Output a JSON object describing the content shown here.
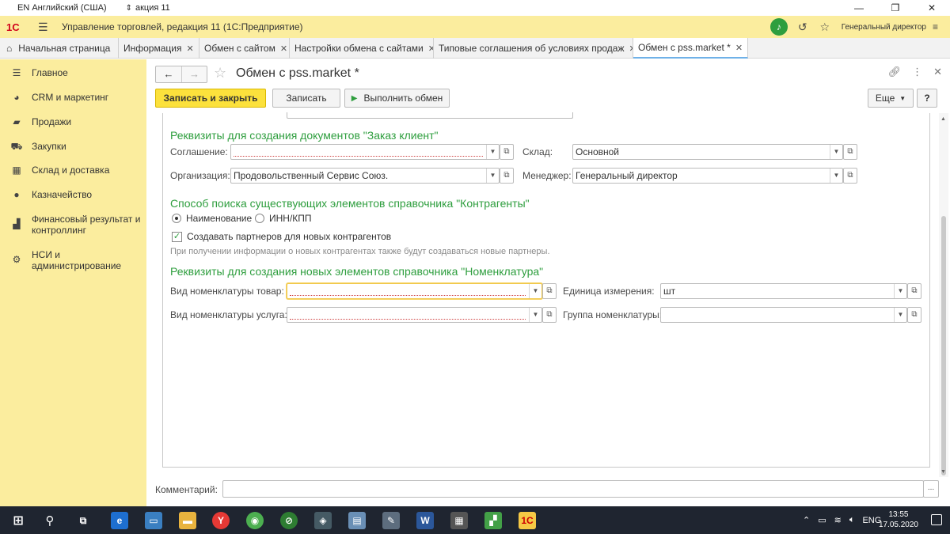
{
  "os": {
    "language": "EN Английский (США)",
    "doc_name": "акция 11",
    "taskbar_time": "13:55",
    "taskbar_date": "17.05.2020"
  },
  "app": {
    "logo": "1С",
    "title": "Управление торговлей, редакция 11  (1С:Предприятие)",
    "user": "Генеральный директор",
    "accent_color": "#fbed9e",
    "primary_button_color": "#fce13c",
    "section_color": "#2e9e3e"
  },
  "tabs": [
    {
      "label": "Начальная страница"
    },
    {
      "label": "Информация"
    },
    {
      "label": "Обмен с сайтом"
    },
    {
      "label": "Настройки обмена с сайтами"
    },
    {
      "label": "Типовые соглашения об условиях продаж"
    },
    {
      "label": "Обмен с pss.market *"
    }
  ],
  "sidebar": {
    "items": [
      {
        "label": "Главное",
        "icon": "menu-icon"
      },
      {
        "label": "CRM и маркетинг",
        "icon": "pie-chart-icon"
      },
      {
        "label": "Продажи",
        "icon": "bag-icon"
      },
      {
        "label": "Закупки",
        "icon": "cart-icon"
      },
      {
        "label": "Склад и доставка",
        "icon": "grid-icon"
      },
      {
        "label": "Казначейство",
        "icon": "coin-icon"
      },
      {
        "label": "Финансовый результат и контроллинг",
        "icon": "bar-chart-icon"
      },
      {
        "label": "НСИ и администрирование",
        "icon": "gear-icon"
      }
    ]
  },
  "form": {
    "title": "Обмен с pss.market *",
    "buttons": {
      "save_close": "Записать и закрыть",
      "save": "Записать",
      "run": "Выполнить обмен",
      "more": "Еще",
      "help": "?"
    },
    "section_order": {
      "title": "Реквизиты для создания документов \"Заказ клиент\"",
      "agreement_label": "Соглашение:",
      "agreement_value": "",
      "warehouse_label": "Склад:",
      "warehouse_value": "Основной",
      "org_label": "Организация:",
      "org_value": "Продовольственный Сервис Союз.",
      "manager_label": "Менеджер:",
      "manager_value": "Генеральный директор"
    },
    "section_search": {
      "title": "Способ поиска существующих элементов справочника \"Контрагенты\"",
      "option_name": "Наименование",
      "option_inn": "ИНН/КПП",
      "selected": "Наименование",
      "create_partners_label": "Создавать партнеров для новых контрагентов",
      "create_partners_checked": true,
      "hint": "При получении информации о новых контрагентах также будут создаваться новые партнеры."
    },
    "section_nom": {
      "title": "Реквизиты для создания новых элементов справочника \"Номенклатура\"",
      "kind_goods_label": "Вид номенклатуры товар:",
      "kind_goods_value": "",
      "unit_label": "Единица измерения:",
      "unit_value": "шт",
      "kind_service_label": "Вид номенклатуры услуга:",
      "kind_service_value": "",
      "group_label": "Группа номенклатуры:",
      "group_value": ""
    },
    "comment_label": "Комментарий:",
    "comment_value": ""
  }
}
